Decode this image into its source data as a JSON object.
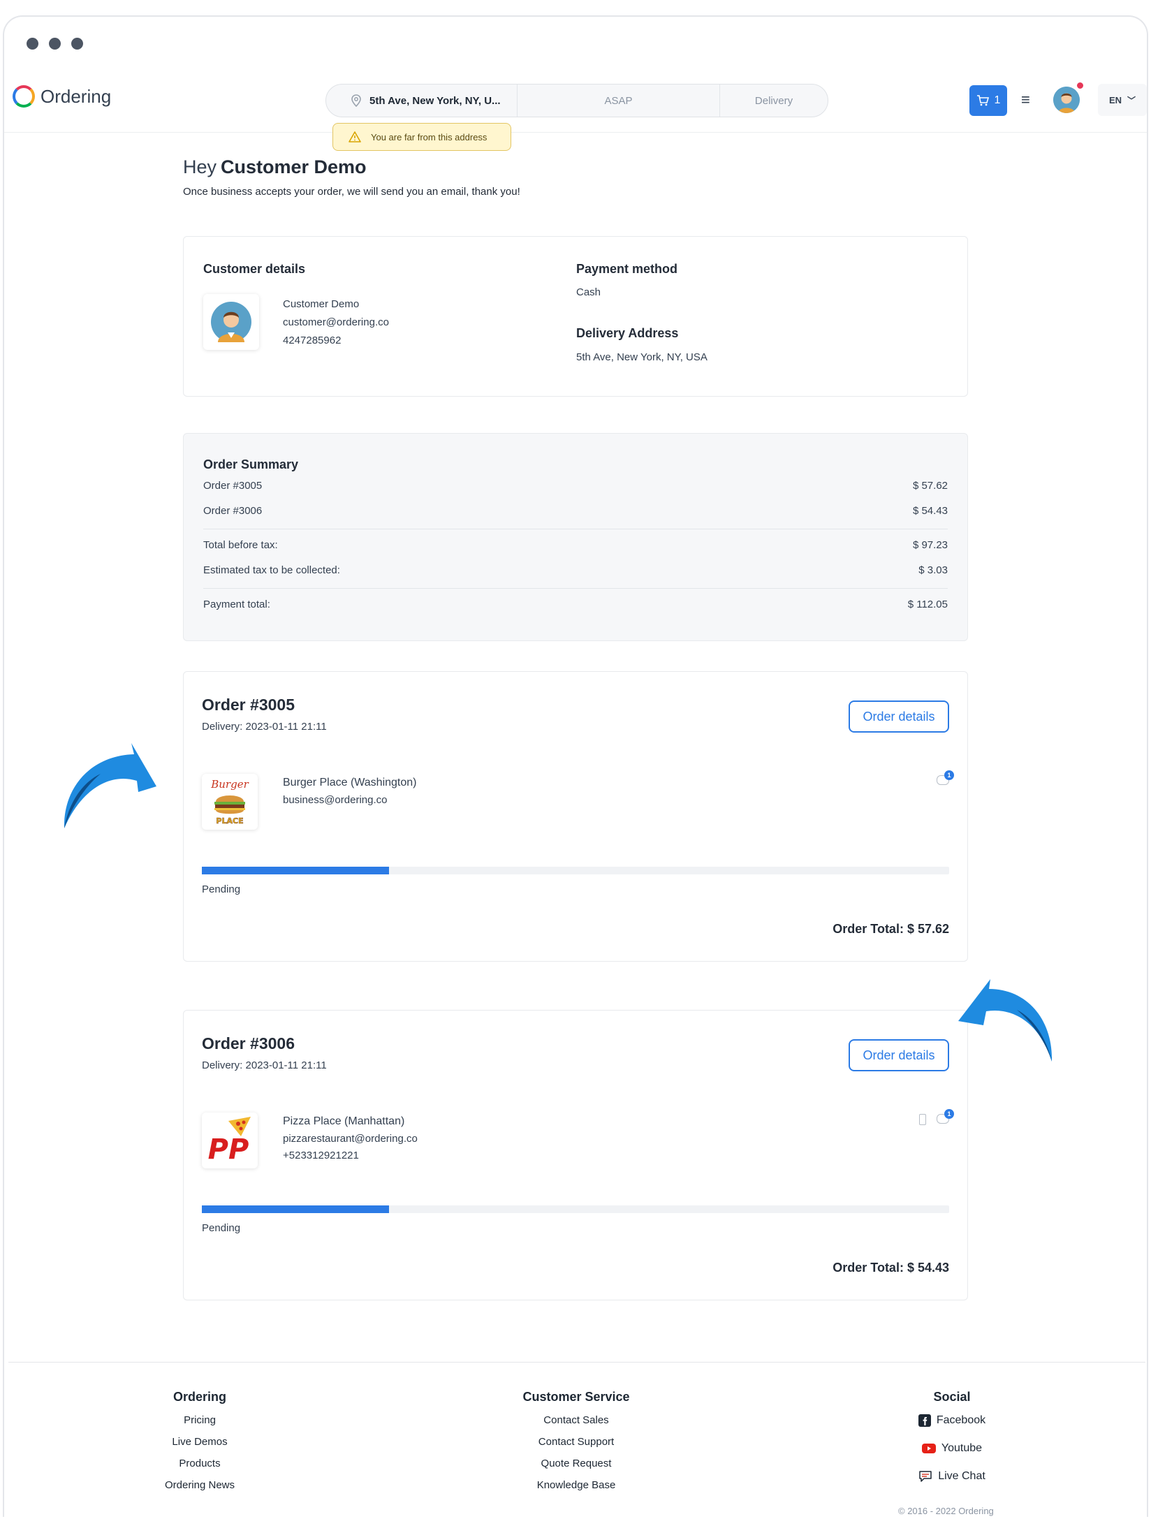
{
  "header": {
    "logo_text": "Ordering",
    "address": "5th Ave, New York, NY, U...",
    "time": "ASAP",
    "order_type": "Delivery",
    "cart_count": "1",
    "language": "EN",
    "warning": "You are far from this address"
  },
  "greeting": {
    "hey": "Hey",
    "name": "Customer Demo",
    "message": "Once business accepts your order, we will send you an email, thank you!"
  },
  "customer": {
    "title": "Customer details",
    "name": "Customer Demo",
    "email": "customer@ordering.co",
    "phone": "4247285962"
  },
  "payment": {
    "title": "Payment method",
    "method": "Cash",
    "address_title": "Delivery Address",
    "address": "5th Ave, New York, NY, USA"
  },
  "summary": {
    "title": "Order Summary",
    "orders": [
      {
        "label": "Order #3005",
        "amount": "$ 57.62"
      },
      {
        "label": "Order #3006",
        "amount": "$ 54.43"
      }
    ],
    "before_tax_label": "Total before tax:",
    "before_tax": "$ 97.23",
    "tax_label": "Estimated tax to be collected:",
    "tax": "$ 3.03",
    "total_label": "Payment total:",
    "total": "$ 112.05"
  },
  "orders": [
    {
      "title": "Order #3005",
      "delivery": "Delivery: 2023-01-11 21:11",
      "details_label": "Order details",
      "business_name": "Burger Place (Washington)",
      "business_email": "business@ordering.co",
      "business_phone": "",
      "status": "Pending",
      "progress": 0.25,
      "total": "Order Total: $ 57.62",
      "chat_badge": "1"
    },
    {
      "title": "Order #3006",
      "delivery": "Delivery: 2023-01-11 21:11",
      "details_label": "Order details",
      "business_name": "Pizza Place (Manhattan)",
      "business_email": "pizzarestaurant@ordering.co",
      "business_phone": "+523312921221",
      "status": "Pending",
      "progress": 0.25,
      "total": "Order Total: $ 54.43",
      "chat_badge": "1"
    }
  ],
  "logos": {
    "burger_top": "Burger",
    "burger_bottom": "PLACE",
    "pizza": "PP"
  },
  "footer": {
    "ordering": {
      "title": "Ordering",
      "links": [
        "Pricing",
        "Live Demos",
        "Products",
        "Ordering News"
      ]
    },
    "service": {
      "title": "Customer Service",
      "links": [
        "Contact Sales",
        "Contact Support",
        "Quote Request",
        "Knowledge Base"
      ]
    },
    "social": {
      "title": "Social",
      "links": [
        "Facebook",
        "Youtube",
        "Live Chat"
      ]
    },
    "copyright": "© 2016 - 2022 Ordering"
  },
  "colors": {
    "primary": "#2c7be5",
    "warning_bg": "#fff6cf",
    "arrow": "#1f8be0"
  }
}
